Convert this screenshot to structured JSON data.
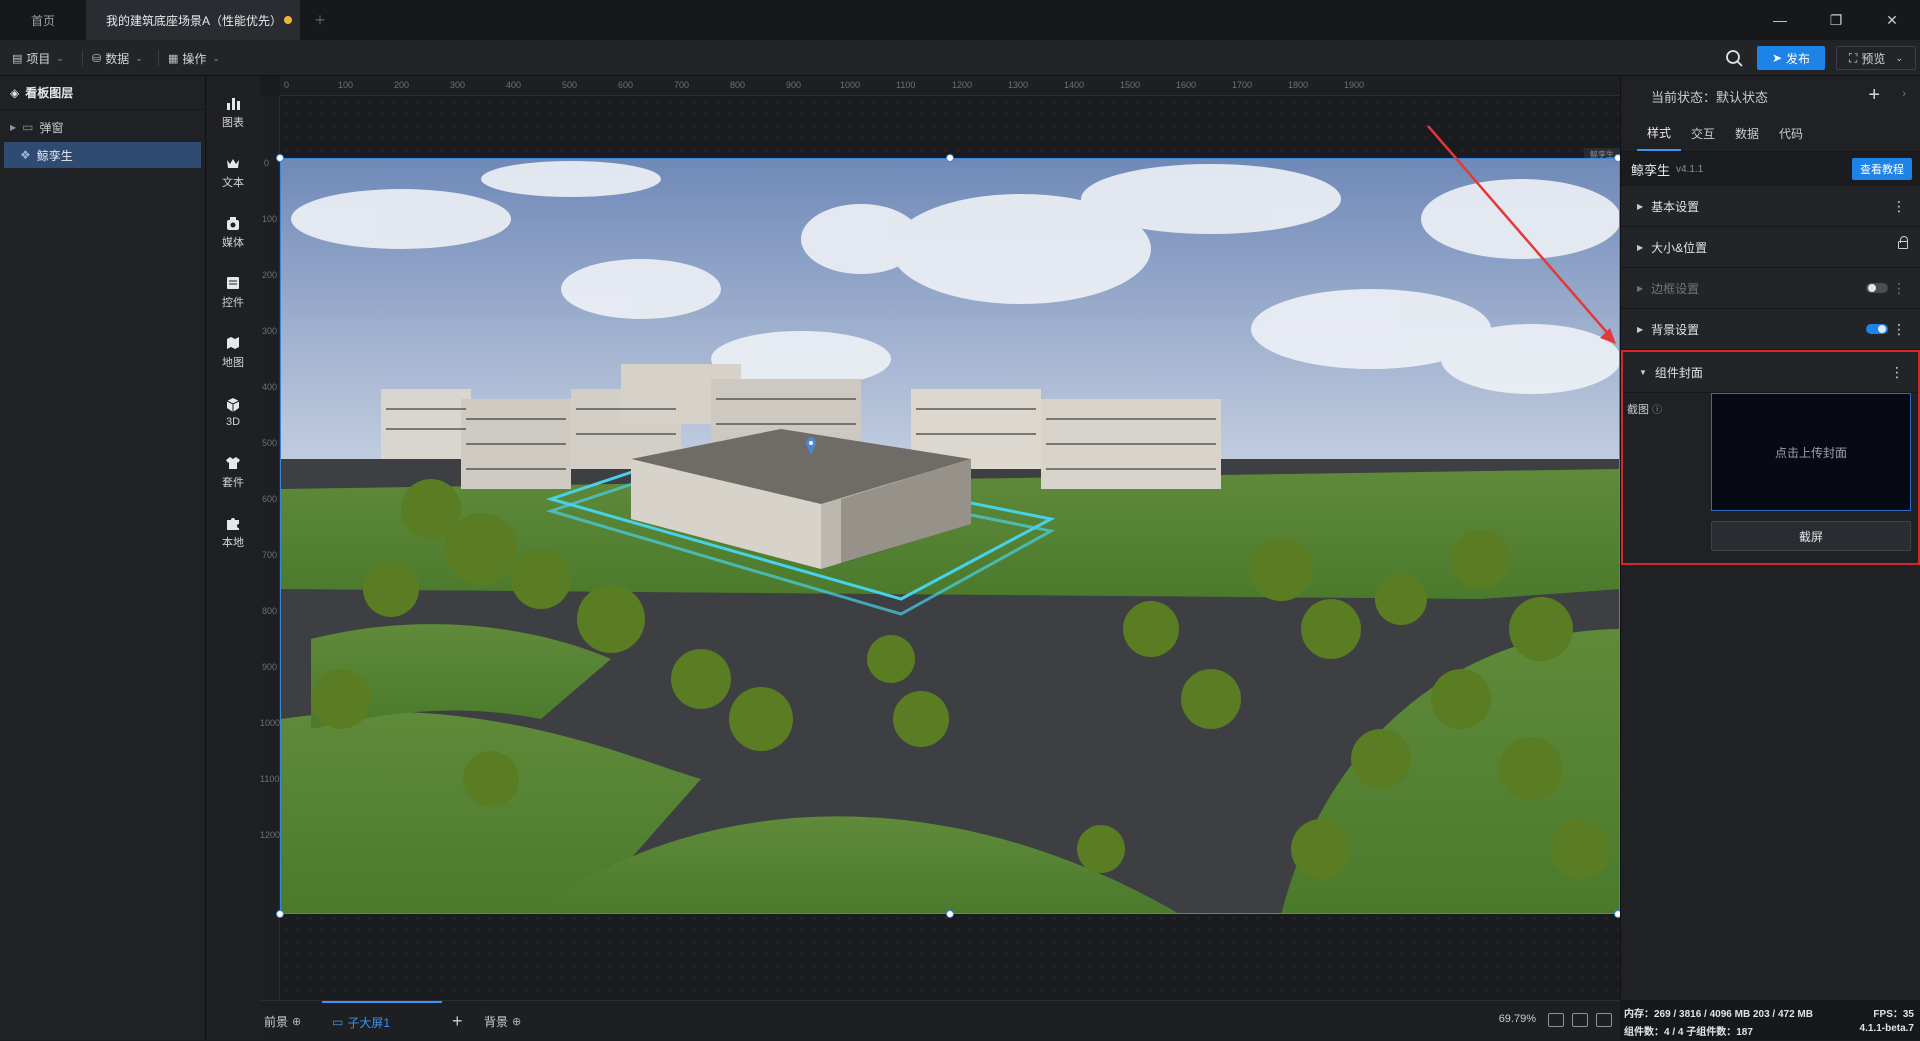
{
  "tabs": {
    "home": "首页",
    "active": "我的建筑底座场景A（性能优先）",
    "add": "+"
  },
  "window": {
    "minimize": "—",
    "restore": "❐",
    "close": "✕"
  },
  "toolbar": {
    "project": "项目",
    "data": "数据",
    "operation": "操作",
    "publish": "发布",
    "preview": "预览"
  },
  "layers": {
    "title": "看板图层",
    "items": [
      {
        "label": "弹窗"
      },
      {
        "label": "鲸孪生"
      }
    ]
  },
  "strip": [
    {
      "label": "图表",
      "icon": "chart-icon"
    },
    {
      "label": "文本",
      "icon": "text-icon"
    },
    {
      "label": "媒体",
      "icon": "media-icon"
    },
    {
      "label": "控件",
      "icon": "control-icon"
    },
    {
      "label": "地图",
      "icon": "map-icon"
    },
    {
      "label": "3D",
      "icon": "cube-icon"
    },
    {
      "label": "套件",
      "icon": "suite-icon"
    },
    {
      "label": "本地",
      "icon": "puzzle-icon"
    }
  ],
  "ruler": {
    "h_ticks": [
      "0",
      "100",
      "200",
      "300",
      "400",
      "500",
      "600",
      "700",
      "800",
      "900",
      "1000",
      "1100",
      "1200",
      "1300",
      "1400",
      "1500",
      "1600",
      "1700",
      "1800",
      "1900"
    ],
    "v_ticks": [
      "0",
      "100",
      "200",
      "300",
      "400",
      "500",
      "600",
      "700",
      "800",
      "900",
      "1000",
      "1100",
      "1200"
    ]
  },
  "canvas": {
    "component_tag": "鲸孪生"
  },
  "bottom": {
    "front": "前景",
    "sub_screen": "子大屏1",
    "add": "+",
    "background": "背景",
    "zoom": "69.79%"
  },
  "rpanel": {
    "state": "当前状态：默认状态",
    "tabs": [
      "样式",
      "交互",
      "数据",
      "代码"
    ],
    "component_name": "鲸孪生",
    "component_version": "v4.1.1",
    "tutorial": "查看教程",
    "sections": [
      {
        "label": "基本设置"
      },
      {
        "label": "大小&位置"
      },
      {
        "label": "边框设置"
      },
      {
        "label": "背景设置"
      },
      {
        "label": "组件封面"
      }
    ],
    "cover": {
      "label": "截图",
      "upload": "点击上传封面",
      "capture": "截屏"
    }
  },
  "status": {
    "memory": "内存：269 / 3816 / 4096 MB  203 / 472 MB",
    "fps": "FPS：35",
    "counts": "组件数：4 / 4   子组件数：187",
    "version": "4.1.1-beta.7"
  },
  "colors": {
    "accent": "#1e83e6",
    "highlight_border": "#d9262a",
    "selection": "#2f4b72",
    "unsaved_dot": "#f2b33d"
  }
}
